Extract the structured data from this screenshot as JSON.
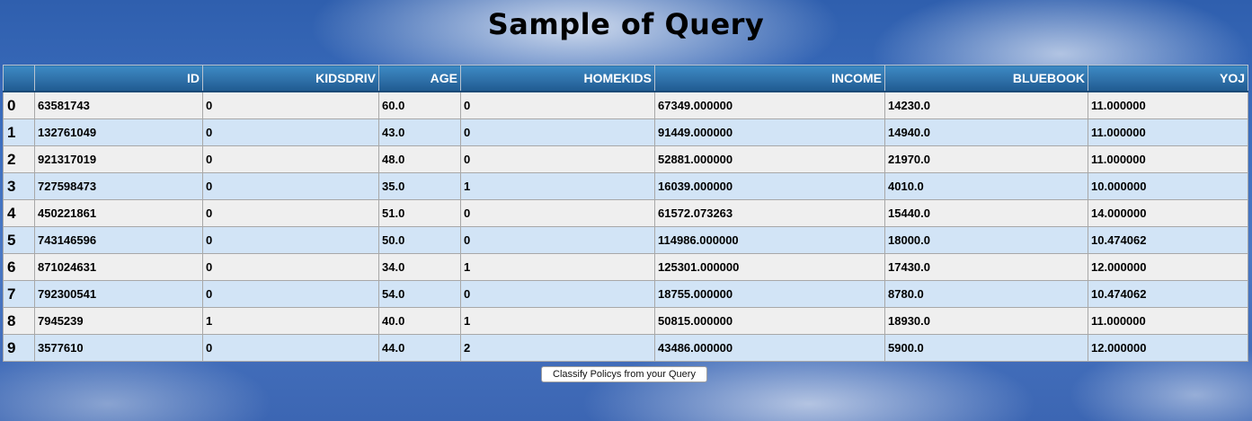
{
  "page": {
    "title": "Sample of Query",
    "button_label": "Classify Policys from your Query"
  },
  "table": {
    "columns": [
      "",
      "ID",
      "KIDSDRIV",
      "AGE",
      "HOMEKIDS",
      "INCOME",
      "BLUEBOOK",
      "YOJ"
    ],
    "rows": [
      [
        "0",
        "63581743",
        "0",
        "60.0",
        "0",
        "67349.000000",
        "14230.0",
        "11.000000"
      ],
      [
        "1",
        "132761049",
        "0",
        "43.0",
        "0",
        "91449.000000",
        "14940.0",
        "11.000000"
      ],
      [
        "2",
        "921317019",
        "0",
        "48.0",
        "0",
        "52881.000000",
        "21970.0",
        "11.000000"
      ],
      [
        "3",
        "727598473",
        "0",
        "35.0",
        "1",
        "16039.000000",
        "4010.0",
        "10.000000"
      ],
      [
        "4",
        "450221861",
        "0",
        "51.0",
        "0",
        "61572.073263",
        "15440.0",
        "14.000000"
      ],
      [
        "5",
        "743146596",
        "0",
        "50.0",
        "0",
        "114986.000000",
        "18000.0",
        "10.474062"
      ],
      [
        "6",
        "871024631",
        "0",
        "34.0",
        "1",
        "125301.000000",
        "17430.0",
        "12.000000"
      ],
      [
        "7",
        "792300541",
        "0",
        "54.0",
        "0",
        "18755.000000",
        "8780.0",
        "10.474062"
      ],
      [
        "8",
        "7945239",
        "1",
        "40.0",
        "1",
        "50815.000000",
        "18930.0",
        "11.000000"
      ],
      [
        "9",
        "3577610",
        "0",
        "44.0",
        "2",
        "43486.000000",
        "5900.0",
        "12.000000"
      ]
    ]
  },
  "colors": {
    "header_blue": "#2d6ea6",
    "row_gray": "#efefef",
    "row_blue": "#d2e4f6",
    "sky_blue": "#3d6fbf"
  }
}
